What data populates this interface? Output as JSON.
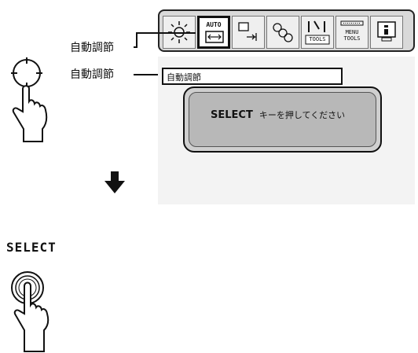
{
  "callouts": {
    "label1": "自動調節",
    "label2": "自動調節"
  },
  "menubar": {
    "tab_auto_text": "AUTO",
    "tab_tools_text": "TOOLS",
    "tab_menu_tools_text1": "MENU",
    "tab_menu_tools_text2": "TOOLS"
  },
  "menu_item": "自動調節",
  "dialog": {
    "key": "SELECT",
    "message": "キーを押してください"
  },
  "select_button_label": "SELECT",
  "icons": [
    "brightness-icon",
    "auto-adjust-icon",
    "position-icon",
    "color-icon",
    "tools-icon",
    "menu-tools-icon",
    "info-icon",
    "joystick-icon",
    "hand-pointer-icon",
    "down-arrow-icon",
    "select-button-icon"
  ]
}
